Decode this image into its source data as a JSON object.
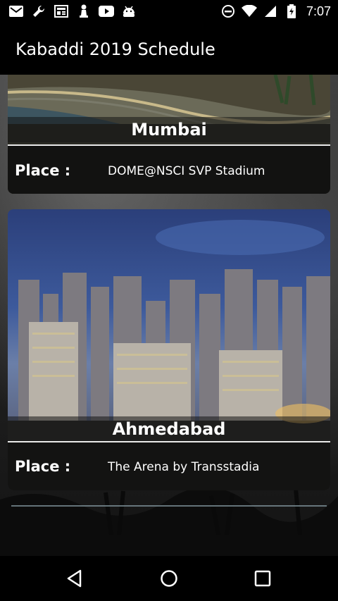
{
  "status_bar": {
    "time": "7:07",
    "left_icons": [
      "mail-icon",
      "wrench-icon",
      "news-icon",
      "chess-pawn-icon",
      "youtube-icon",
      "android-icon"
    ],
    "right_icons": [
      "do-not-disturb-icon",
      "wifi-icon",
      "signal-icon",
      "battery-charging-icon"
    ]
  },
  "app_bar": {
    "title": "Kabaddi 2019 Schedule"
  },
  "venues": [
    {
      "city": "Mumbai",
      "place_label": "Place :",
      "place": "DOME@NSCI SVP Stadium"
    },
    {
      "city": "Ahmedabad",
      "place_label": "Place :",
      "place": "The Arena by Transstadia"
    }
  ],
  "nav_bar": {
    "buttons": [
      "back-icon",
      "home-icon",
      "recents-icon"
    ]
  }
}
